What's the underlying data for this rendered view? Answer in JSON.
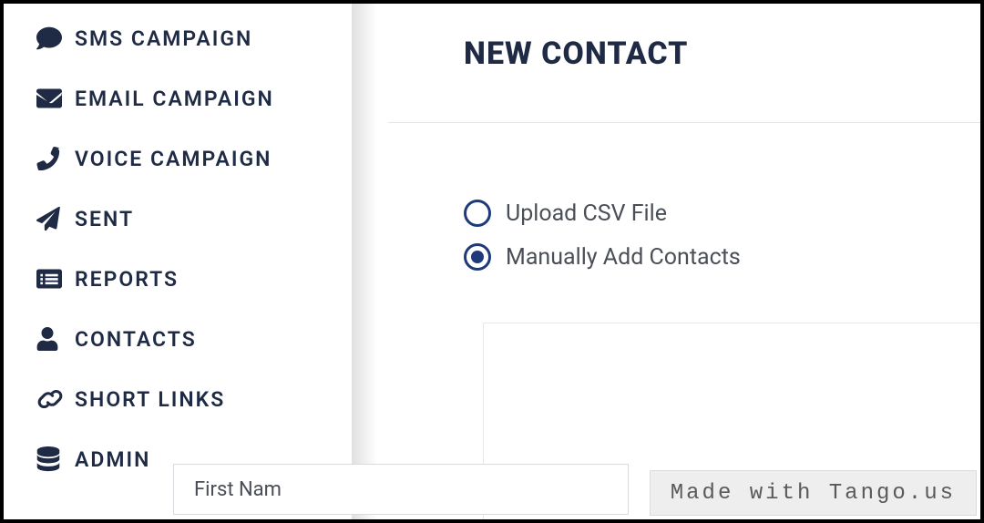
{
  "sidebar": {
    "items": [
      {
        "label": "SMS CAMPAIGN"
      },
      {
        "label": "EMAIL CAMPAIGN"
      },
      {
        "label": "VOICE CAMPAIGN"
      },
      {
        "label": "SENT"
      },
      {
        "label": "REPORTS"
      },
      {
        "label": "CONTACTS"
      },
      {
        "label": "SHORT LINKS"
      },
      {
        "label": "ADMIN"
      }
    ]
  },
  "page": {
    "title": "NEW CONTACT"
  },
  "import_mode": {
    "options": [
      {
        "label": "Upload CSV File",
        "selected": false
      },
      {
        "label": "Manually Add Contacts",
        "selected": true
      }
    ]
  },
  "form": {
    "first_name_placeholder": "First Nam"
  },
  "watermark": "Made with Tango.us"
}
